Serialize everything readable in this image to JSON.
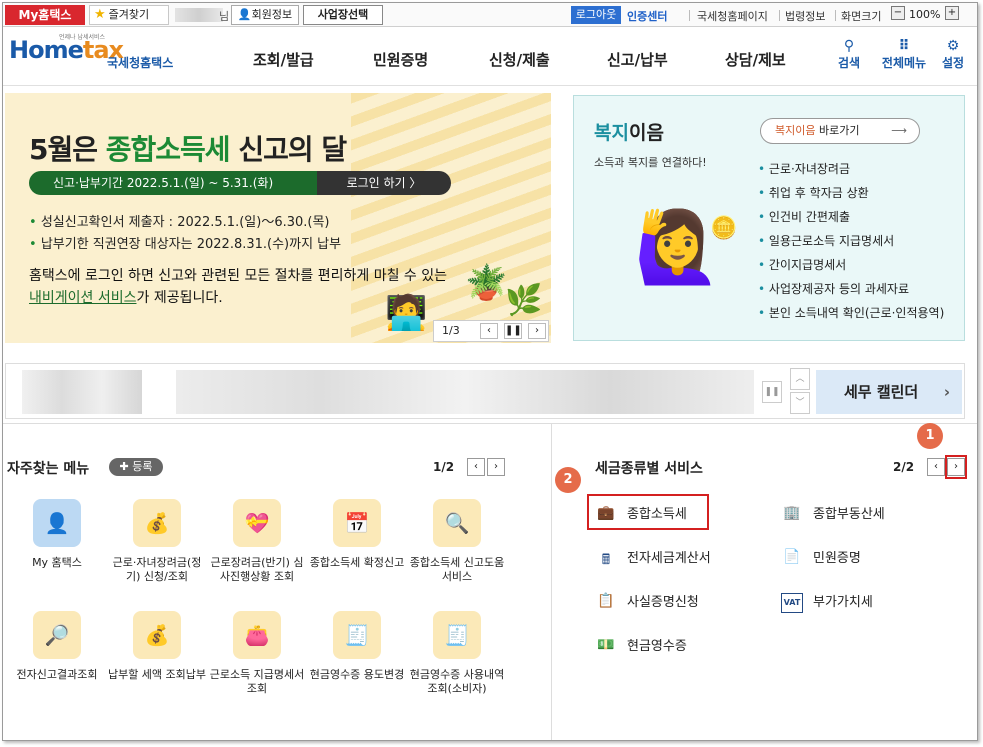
{
  "topbar": {
    "my_hometax": "My홈택스",
    "favorites": "즐겨찾기",
    "name_suffix": "님",
    "member_info": "회원정보",
    "biz_select": "사업장선택",
    "logout": "로그아웃",
    "cert_center": "인증센터",
    "nts_page": "국세청홈페이지",
    "law_info": "법령정보",
    "screen_size": "화면크기",
    "zoom_minus": "−",
    "zoom_value": "100%",
    "zoom_plus": "+"
  },
  "header": {
    "logo_main": "Home",
    "logo_tax": "tax",
    "logo_kor": "국세청홈택스",
    "logo_tiny": "언제나 납세서비스",
    "nav": [
      "조회/발급",
      "민원증명",
      "신청/제출",
      "신고/납부",
      "상담/제보"
    ],
    "tools": {
      "search": "검색",
      "all_menu": "전체메뉴",
      "settings": "설정"
    }
  },
  "banner": {
    "title_pre": "5월은 ",
    "title_em": "종합소득세",
    "title_post": " 신고의 달",
    "period": "신고·납부기간  2022.5.1.(일) ~ 5.31.(화)",
    "login_btn": "로그인 하기  〉",
    "bullets": [
      "성실신고확인서 제출자 : 2022.5.1.(일)～6.30.(목)",
      "납부기한 직권연장 대상자는 2022.8.31.(수)까지 납부"
    ],
    "desc_pre": "홈택스에 로그인 하면 신고와 관련된 모든 절차를 편리하게 마칠 수 있는 ",
    "desc_link": "내비게이션 서비스",
    "desc_post": "가 제공됩니다.",
    "pager": "1/3"
  },
  "welfare": {
    "title_colored": "복지",
    "title_rest": "이음",
    "subtitle": "소득과 복지를 연결하다!",
    "go_colored": "복지이음",
    "go_rest": " 바로가기",
    "items": [
      "근로·자녀장려금",
      "취업 후 학자금 상환",
      "인건비 간편제출",
      "일용근로소득 지급명세서",
      "간이지급명세서",
      "사업장제공자 등의 과세자료",
      "본인 소득내역 확인(근로·인적용역)"
    ]
  },
  "ticker": {
    "calendar": "세무 캘린더"
  },
  "freq": {
    "title": "자주찾는 메뉴",
    "register": "등록",
    "page": "1/2",
    "items": [
      "My 홈택스",
      "근로·자녀장려금(정기) 신청/조회",
      "근로장려금(반기) 심사진행상황 조회",
      "종합소득세 확정신고",
      "종합소득세 신고도움 서비스",
      "전자신고결과조회",
      "납부할 세액 조회납부",
      "근로소득 지급명세서 조회",
      "현금영수증 용도변경",
      "현금영수증 사용내역조회(소비자)"
    ]
  },
  "taxsvc": {
    "title": "세금종류별 서비스",
    "page": "2/2",
    "items": [
      "종합소득세",
      "종합부동산세",
      "전자세금계산서",
      "민원증명",
      "사실증명신청",
      "부가가치세",
      "현금영수증"
    ]
  },
  "annotations": {
    "badge1": "1",
    "badge2": "2"
  }
}
